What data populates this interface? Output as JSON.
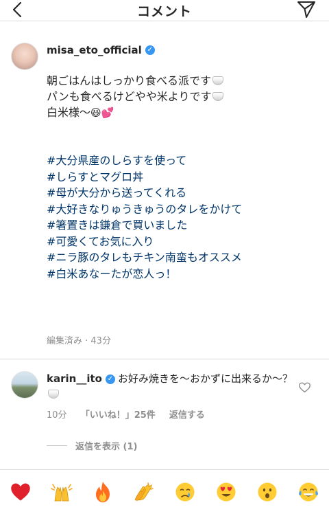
{
  "header": {
    "title": "コメント"
  },
  "post": {
    "username": "misa_eto_official",
    "caption_lines": [
      "朝ごはんはしっかり食べる派です",
      "パンも食べるけどやや米よりです",
      "白米様〜"
    ],
    "hashtags": [
      "#大分県産のしらすを使って",
      "#しらすとマグロ丼",
      "#母が大分から送ってくれる",
      "#大好きなりゅうきゅうのタレをかけて",
      "#箸置きは鎌倉で買いました",
      "#可愛くてお気に入り",
      "#ニラ豚のタレもチキン南蛮もオススメ",
      "#白米あなーたが恋人っ！"
    ],
    "meta": "編集済み · 43分"
  },
  "reply": {
    "username": "karin__ito",
    "text": "お好み焼きを〜おかずに出来るか〜？",
    "time": "10分",
    "likes": "「いいね！」25件",
    "reply_action": "返信する",
    "view_replies": "返信を表示 (1)"
  },
  "reactions": [
    "red-heart",
    "raising-hands",
    "fire",
    "clapping-hands",
    "crying-face",
    "heart-eyes-face",
    "surprised-face",
    "tears-of-joy-face"
  ],
  "colors": {
    "hashtag": "#003569",
    "verified": "#3897f0",
    "muted": "#8e8e8e"
  }
}
